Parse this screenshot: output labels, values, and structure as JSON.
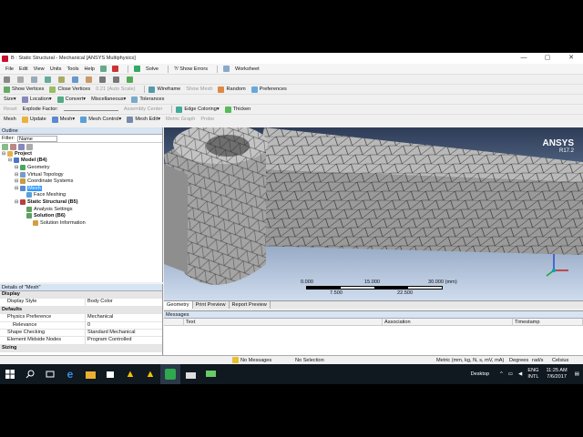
{
  "window": {
    "title": "B : Static Structural - Mechanical [ANSYS Multiphysics]"
  },
  "menu": [
    "File",
    "Edit",
    "View",
    "Units",
    "Tools",
    "Help"
  ],
  "toolbar1": {
    "solve": "Solve",
    "show_errors": "?/ Show Errors",
    "worksheet": "Worksheet"
  },
  "toolbar2": {
    "show_vertices": "Show Vertices",
    "close_vertices": "Close Vertices",
    "auto_scale": "0.21 (Auto Scale)",
    "wireframe": "Wireframe",
    "show_mesh": "Show Mesh",
    "random": "Random",
    "preferences": "Preferences"
  },
  "toolbar3": {
    "size": "Size",
    "location": "Location",
    "convert": "Convert",
    "misc": "Miscellaneous",
    "tolerances": "Tolerances"
  },
  "toolbar4": {
    "reset": "Reset",
    "explode": "Explode Factor:",
    "assembly_center": "Assembly Center",
    "edge_coloring": "Edge Coloring",
    "thicken": "Thicken"
  },
  "toolbar5": {
    "mesh": "Mesh",
    "update": "Update",
    "mesh_menu": "Mesh",
    "mesh_control": "Mesh Control",
    "mesh_edit": "Mesh Edit",
    "metric_graph": "Metric Graph",
    "probe": "Probe"
  },
  "outline": {
    "header": "Outline",
    "filter_label": "Filter:",
    "filter_value": "Name",
    "tree": [
      {
        "label": "Project",
        "bold": true,
        "indent": 0,
        "color": "#e8b04a"
      },
      {
        "label": "Model (B4)",
        "bold": true,
        "indent": 1,
        "color": "#4a78c8"
      },
      {
        "label": "Geometry",
        "bold": false,
        "indent": 2,
        "color": "#4aa860"
      },
      {
        "label": "Virtual Topology",
        "bold": false,
        "indent": 2,
        "color": "#7a9acc"
      },
      {
        "label": "Coordinate Systems",
        "bold": false,
        "indent": 2,
        "color": "#c89c40"
      },
      {
        "label": "Mesh",
        "bold": false,
        "indent": 2,
        "color": "#5a8ad0",
        "selected": true
      },
      {
        "label": "Face Meshing",
        "bold": false,
        "indent": 3,
        "color": "#5aa0d8"
      },
      {
        "label": "Static Structural (B5)",
        "bold": true,
        "indent": 2,
        "color": "#b84040"
      },
      {
        "label": "Analysis Settings",
        "bold": false,
        "indent": 3,
        "color": "#60a060"
      },
      {
        "label": "Solution (B6)",
        "bold": true,
        "indent": 3,
        "color": "#60a060"
      },
      {
        "label": "Solution Information",
        "bold": false,
        "indent": 4,
        "color": "#d0a040"
      }
    ]
  },
  "details": {
    "header": "Details of \"Mesh\"",
    "groups": [
      {
        "name": "Display",
        "rows": [
          {
            "k": "Display Style",
            "v": "Body Color"
          }
        ]
      },
      {
        "name": "Defaults",
        "rows": [
          {
            "k": "Physics Preference",
            "v": "Mechanical"
          },
          {
            "k": "Relevance",
            "v": "0"
          },
          {
            "k": "Shape Checking",
            "v": "Standard Mechanical"
          },
          {
            "k": "Element Midside Nodes",
            "v": "Program Controlled"
          }
        ]
      },
      {
        "name": "Sizing",
        "rows": []
      }
    ]
  },
  "viewport": {
    "brand": "ANSYS",
    "version": "R17.2",
    "scale_top": [
      "0.000",
      "15.000",
      "30.000 (mm)"
    ],
    "scale_bottom": [
      "7.500",
      "22.500"
    ]
  },
  "tabs": [
    "Geometry",
    "Print Preview",
    "Report Preview"
  ],
  "messages": {
    "header": "Messages",
    "cols": [
      "Text",
      "Association",
      "Timestamp"
    ]
  },
  "status": {
    "messages": "No Messages",
    "selection": "No Selection",
    "units": "Metric (mm, kg, N, s, mV, mA)",
    "angle": "Degrees",
    "rate": "rad/s",
    "temp": "Celsius"
  },
  "taskbar": {
    "desktop": "Desktop",
    "lang1": "ENG",
    "lang2": "INTL",
    "time": "11:25 AM",
    "date": "7/6/2017"
  },
  "colors": {
    "selection": "#3399ff",
    "ansys_red": "#c8102e",
    "panel_header": "#d7e4f2",
    "taskbar": "#101820"
  }
}
